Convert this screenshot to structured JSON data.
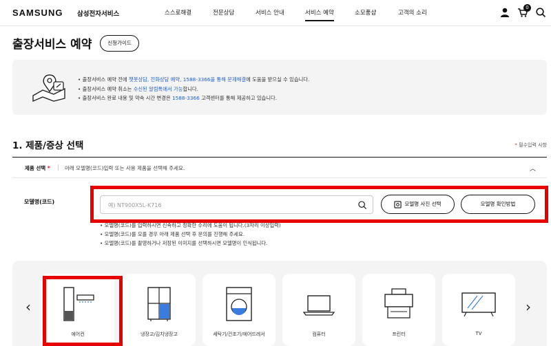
{
  "header": {
    "logo": "SAMSUNG",
    "logo_sub": "삼성전자서비스",
    "nav": [
      "스스로해결",
      "전문상담",
      "서비스 안내",
      "서비스 예약",
      "소모품샵",
      "고객의 소리"
    ],
    "active_nav": "서비스 예약",
    "cart_count": "0",
    "icons": [
      "user-icon",
      "cart-icon",
      "search-icon"
    ]
  },
  "page": {
    "title": "출장서비스 예약",
    "guide_button": "신청가이드"
  },
  "notice": {
    "items": [
      {
        "pre": "출장서비스 예약 전에 ",
        "hl": "챗봇상담, 전화상담 예약, 1588-3366을 통해 문제해결",
        "post": "에 도움을 받으실 수 있습니다."
      },
      {
        "pre": "출장서비스 예약 취소는 ",
        "hl": "수신된 알림톡에서 가능",
        "post": "합니다."
      },
      {
        "pre": "출장서비스 완료 내용 및 약속 시간 변경은 ",
        "hl": "1588-3366",
        "post": " 고객센터를 통해 제공하고 있습니다."
      }
    ]
  },
  "section": {
    "title": "1. 제품/증상 선택",
    "required_note": "필수입력 사항",
    "required_mark": "*",
    "select_label": "제품 선택",
    "select_desc": "아래 모델명(코드)입력 또는 사용 제품을 선택해 주세요."
  },
  "model": {
    "label": "모델명(코드)",
    "placeholder": "예) NT900X5L-K716",
    "photo_button": "모델명 사진 선택",
    "howto_button": "모델명 확인방법",
    "help": [
      "모델명(코드)를 입력하시면 신속하고 정확한 수리에 도움이 됩니다.(3자리 이상입력)",
      "모델명(코드)를 모를 경우 아래 제품 선택 후 문의를 진행해 주세요.",
      "모델명(코드)를 촬영하거나 저장된 이미지를 선택하시면 모델명이 인식됩니다."
    ]
  },
  "products": [
    {
      "label": "에어컨",
      "icon": "air-conditioner-icon"
    },
    {
      "label": "냉장고/김치냉장고",
      "icon": "refrigerator-icon"
    },
    {
      "label": "세탁기/건조기/에어드레서",
      "icon": "washing-machine-icon"
    },
    {
      "label": "컴퓨터",
      "icon": "laptop-icon"
    },
    {
      "label": "프린터",
      "icon": "printer-icon"
    },
    {
      "label": "TV",
      "icon": "tv-icon"
    }
  ],
  "colors": {
    "highlight": "#e60000",
    "link": "#1f5fd6",
    "panel": "#f4f4f4"
  }
}
